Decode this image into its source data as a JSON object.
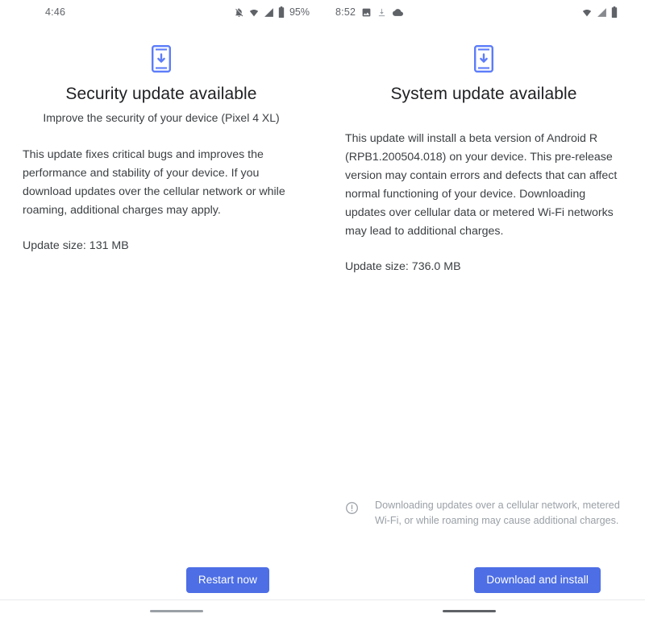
{
  "left_screen": {
    "status_bar": {
      "time": "4:46",
      "battery_percent": "95%",
      "icons": [
        "notifications-off-icon",
        "wifi-icon",
        "signal-icon",
        "battery-icon"
      ]
    },
    "update_icon": "phone-download-icon",
    "title": "Security update available",
    "subtitle": "Improve the security of your device (Pixel 4 XL)",
    "body": "This update fixes critical bugs and improves the performance and stability of your device. If you download updates over the cellular network or while roaming, additional charges may apply.",
    "update_size": "Update size: 131 MB",
    "primary_button": "Restart now",
    "gesture_bar": "home-gesture-bar"
  },
  "right_screen": {
    "status_bar": {
      "time": "8:52",
      "left_icons": [
        "photo-icon",
        "download-icon",
        "cloud-icon"
      ],
      "right_icons": [
        "wifi-icon",
        "signal-icon",
        "battery-icon"
      ]
    },
    "update_icon": "phone-download-icon",
    "title": "System update available",
    "body": "This update will install a beta version of Android R (RPB1.200504.018) on your device. This pre-release version may contain errors and defects that can affect normal functioning of your device. Downloading updates over cellular data or metered Wi-Fi networks may lead to additional charges.",
    "update_size": "Update size: 736.0 MB",
    "note": {
      "icon": "error-outline-icon",
      "text": "Downloading updates over a cellular network, metered Wi-Fi, or while roaming may cause additional charges."
    },
    "primary_button": "Download and install",
    "gesture_bar": "home-gesture-bar"
  },
  "colors": {
    "accent_blue": "#4d6ee5",
    "icon_blue": "#5c7cfa",
    "text_primary": "#202124",
    "text_secondary": "#3c4043",
    "text_muted": "#9aa0a6",
    "background": "#ffffff"
  }
}
